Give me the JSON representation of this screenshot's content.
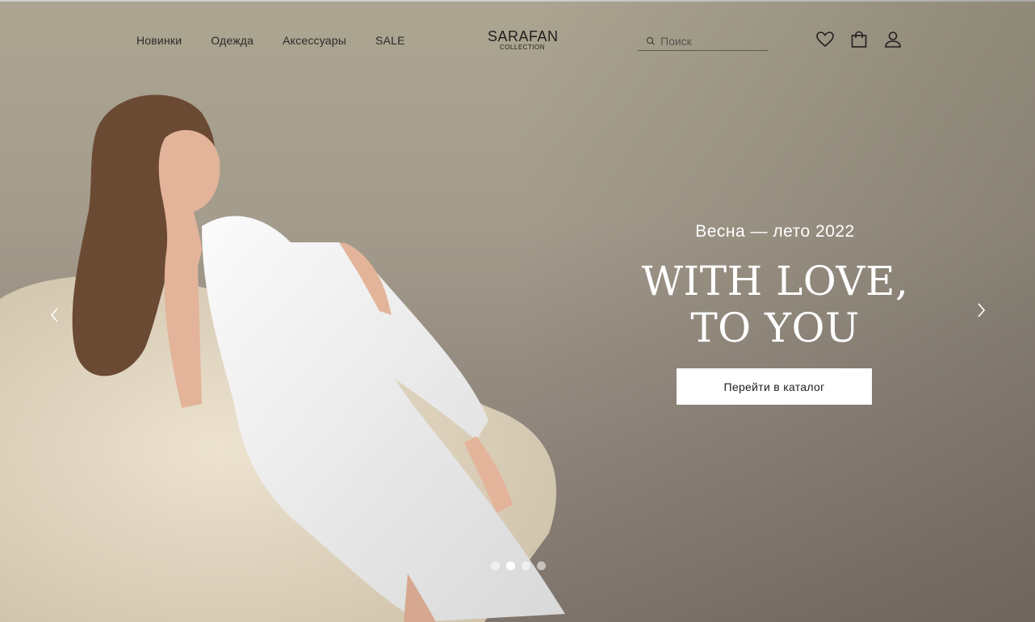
{
  "nav": {
    "items": [
      {
        "label": "Новинки"
      },
      {
        "label": "Одежда"
      },
      {
        "label": "Аксессуары"
      },
      {
        "label": "SALE"
      }
    ]
  },
  "logo": {
    "main": "SARAFAN",
    "sub": "COLLECTION"
  },
  "search": {
    "placeholder": "Поиск",
    "value": ""
  },
  "header_icons": [
    "heart-icon",
    "shopping-bag-icon",
    "user-icon"
  ],
  "hero": {
    "season": "Весна — лето 2022",
    "title_line1": "WITH LOVE,",
    "title_line2": "TO YOU",
    "cta_label": "Перейти в каталог"
  },
  "slider": {
    "total": 4,
    "active": 2
  },
  "colors": {
    "accent": "#ffffff",
    "text": "#2b2a28",
    "dress": "#f2f2f2",
    "chair": "#e6dac5"
  }
}
